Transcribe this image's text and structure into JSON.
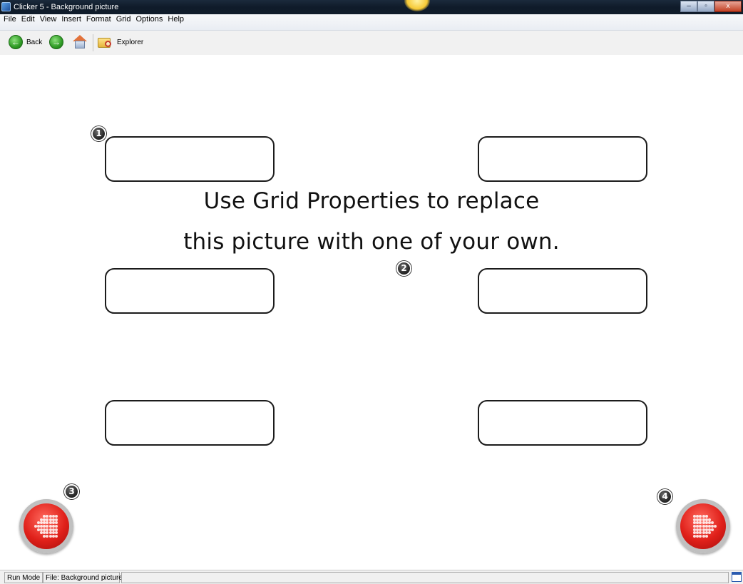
{
  "window": {
    "title": "Clicker 5 - Background picture",
    "controls": [
      "minimize-icon",
      "restore-icon",
      "close-icon"
    ],
    "minimize_glyph": "–",
    "restore_glyph": "▫",
    "close_glyph": "x"
  },
  "menu": {
    "items": [
      "File",
      "Edit",
      "View",
      "Insert",
      "Format",
      "Grid",
      "Options",
      "Help"
    ]
  },
  "toolbar": {
    "back_label": "Back",
    "explorer_label": "Explorer",
    "back_glyph": "←",
    "forward_glyph": "→"
  },
  "grid": {
    "background_text_line1": "Use Grid Properties to replace",
    "background_text_line2": "this picture with one of your own.",
    "cells": [
      "",
      "",
      "",
      "",
      "",
      ""
    ],
    "callouts": [
      "1",
      "2",
      "3",
      "4"
    ],
    "nav_color": "#e0201a"
  },
  "status": {
    "mode": "Run Mode",
    "file": "File: Background picture"
  }
}
